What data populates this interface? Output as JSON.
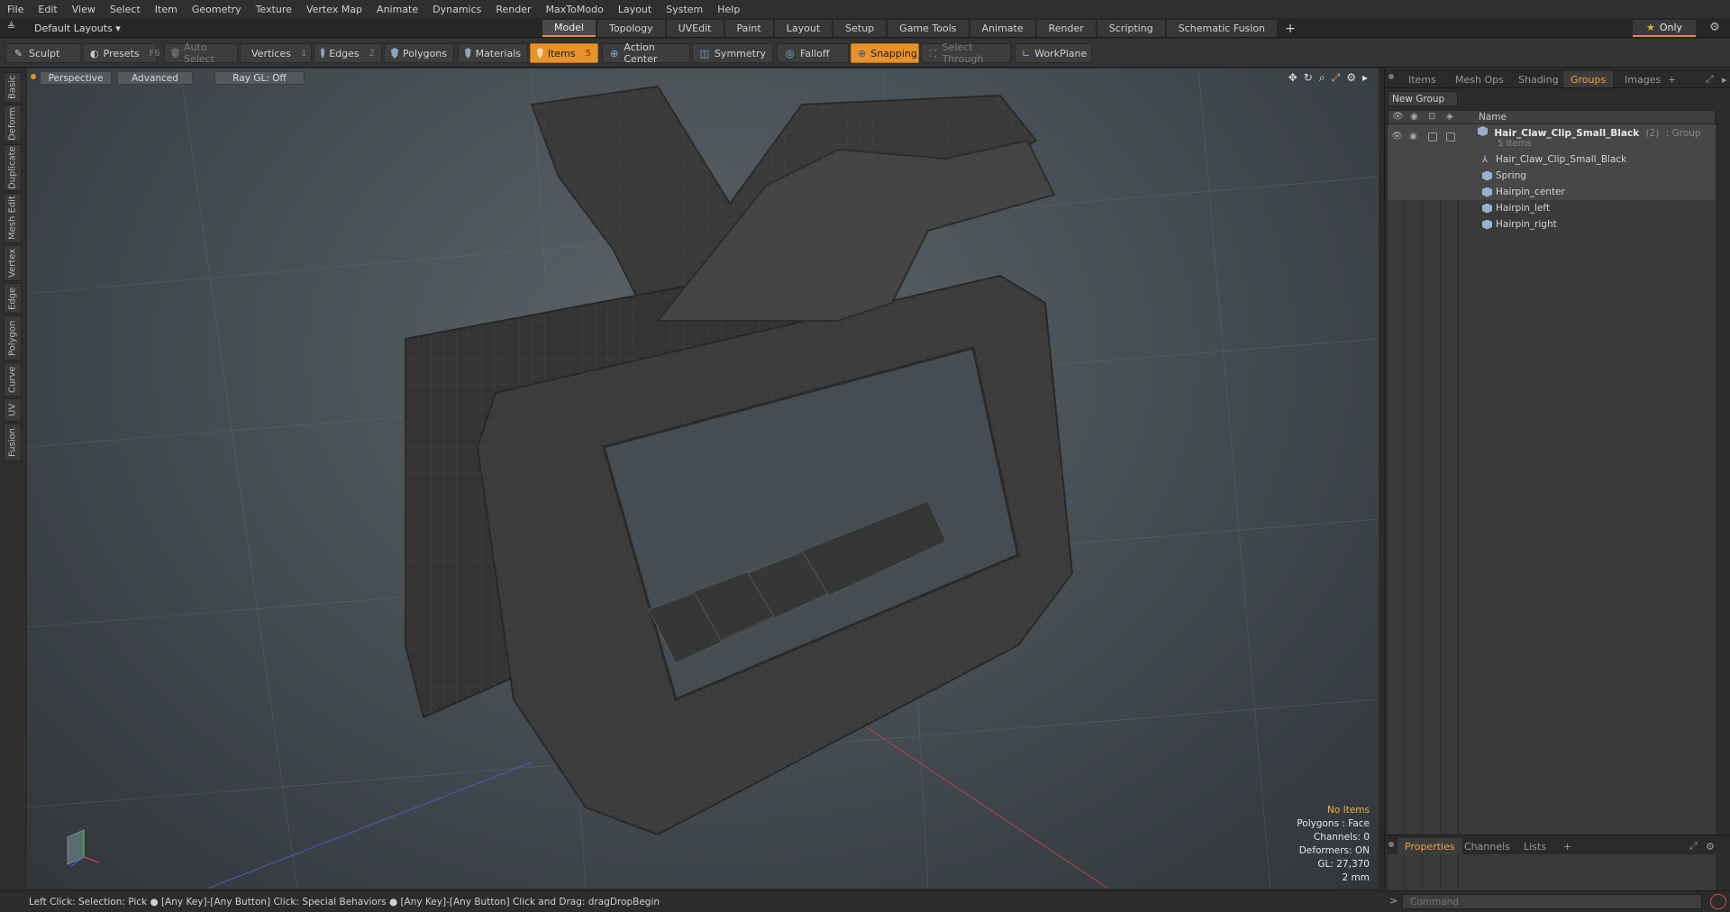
{
  "menu": [
    "File",
    "Edit",
    "View",
    "Select",
    "Item",
    "Geometry",
    "Texture",
    "Vertex Map",
    "Animate",
    "Dynamics",
    "Render",
    "MaxToModo",
    "Layout",
    "System",
    "Help"
  ],
  "layout": {
    "dropdown": "Default Layouts ▾",
    "only_label": "Only"
  },
  "layout_tabs": [
    {
      "label": "Model",
      "active": true
    },
    {
      "label": "Topology",
      "active": false
    },
    {
      "label": "UVEdit",
      "active": false
    },
    {
      "label": "Paint",
      "active": false
    },
    {
      "label": "Layout",
      "active": false
    },
    {
      "label": "Setup",
      "active": false
    },
    {
      "label": "Game Tools",
      "active": false
    },
    {
      "label": "Animate",
      "active": false
    },
    {
      "label": "Render",
      "active": false
    },
    {
      "label": "Scripting",
      "active": false
    },
    {
      "label": "Schematic Fusion",
      "active": false
    }
  ],
  "toolbar": {
    "sculpt": "Sculpt",
    "presets": "Presets",
    "presets_key": "F6",
    "auto_select": "Auto Select",
    "vertices": "Vertices",
    "vertices_key": "1",
    "edges": "Edges",
    "edges_key": "2",
    "polygons": "Polygons",
    "materials": "Materials",
    "items": "Items",
    "items_key": "5",
    "action_center": "Action Center",
    "symmetry": "Symmetry",
    "falloff": "Falloff",
    "snapping": "Snapping",
    "select_through": "Select Through",
    "workplane": "WorkPlane"
  },
  "left_tabs": [
    "Basic",
    "Deform",
    "Duplicate",
    "Mesh Edit",
    "Vertex",
    "Edge",
    "Polygon",
    "Curve",
    "UV",
    "Fusion"
  ],
  "viewport": {
    "view": "Perspective",
    "shading": "Advanced",
    "raygl": "Ray GL: Off",
    "info": {
      "selection": "No Items",
      "polygons": "Polygons : Face",
      "channels": "Channels: 0",
      "deformers": "Deformers: ON",
      "gl": "GL: 27,370",
      "unit": "2 mm"
    }
  },
  "right_panel": {
    "tabs": [
      {
        "label": "Items",
        "active": false
      },
      {
        "label": "Mesh Ops",
        "active": false
      },
      {
        "label": "Shading",
        "active": false
      },
      {
        "label": "Groups",
        "active": true
      },
      {
        "label": "Images",
        "active": false
      }
    ],
    "new_group": "New Group",
    "name_col": "Name",
    "group": {
      "name": "Hair_Claw_Clip_Small_Black",
      "count": "(2)",
      "type": ": Group",
      "items": "5 Items"
    },
    "children": [
      {
        "name": "Hair_Claw_Clip_Small_Black",
        "icon": "locator-icon"
      },
      {
        "name": "Spring",
        "icon": "mesh-icon"
      },
      {
        "name": "Hairpin_center",
        "icon": "mesh-icon"
      },
      {
        "name": "Hairpin_left",
        "icon": "mesh-icon"
      },
      {
        "name": "Hairpin_right",
        "icon": "mesh-icon"
      }
    ],
    "bottom_tabs": [
      {
        "label": "Properties",
        "active": true
      },
      {
        "label": "Channels",
        "active": false
      },
      {
        "label": "Lists",
        "active": false
      }
    ]
  },
  "status": "Left Click: Selection: Pick ● [Any Key]-[Any Button] Click: Special Behaviors ● [Any Key]-[Any Button] Click and Drag: dragDropBegin",
  "command_placeholder": "Command",
  "colors": {
    "accent": "#e8922a",
    "viewport_bg": "#4a5257",
    "model": "#3d3d3d"
  }
}
